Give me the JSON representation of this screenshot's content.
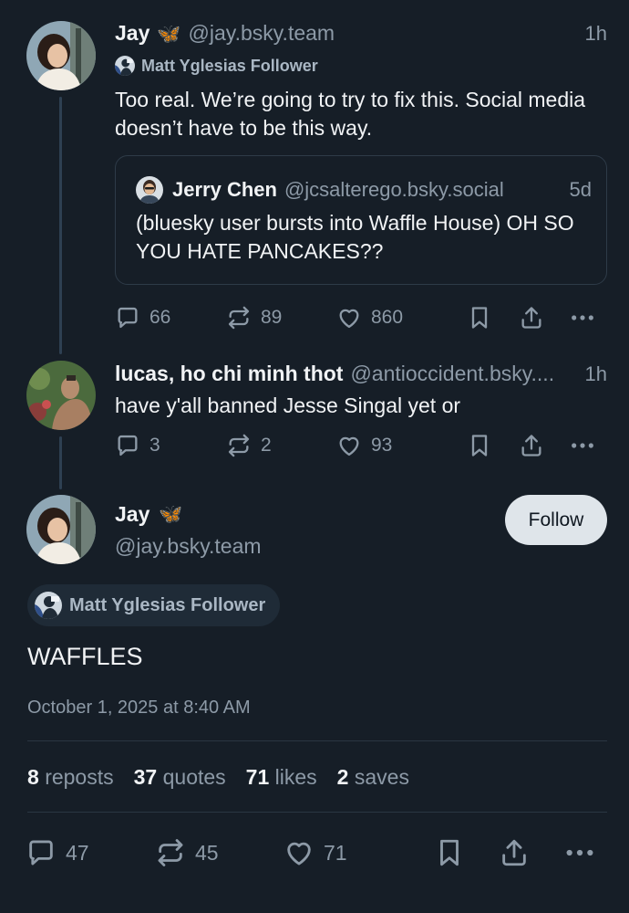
{
  "thread": [
    {
      "author_name": "Jay",
      "author_emoji": "🦋",
      "handle": "@jay.bsky.team",
      "time": "1h",
      "badge": "Matt Yglesias Follower",
      "text": "Too real. We’re going to try to fix this. Social media doesn’t have to be this way.",
      "quote": {
        "author_name": "Jerry Chen",
        "handle": "@jcsalterego.bsky.social",
        "time": "5d",
        "text": "(bluesky user bursts into Waffle House) OH SO YOU HATE PANCAKES??"
      },
      "replies": "66",
      "reposts": "89",
      "likes": "860"
    },
    {
      "author_name": "lucas, ho chi minh thot",
      "handle": "@antioccident.bsky....",
      "time": "1h",
      "text": "have y'all banned Jesse Singal yet or",
      "replies": "3",
      "reposts": "2",
      "likes": "93"
    }
  ],
  "main_post": {
    "author_name": "Jay",
    "author_emoji": "🦋",
    "handle": "@jay.bsky.team",
    "follow_label": "Follow",
    "badge": "Matt Yglesias Follower",
    "text": "WAFFLES",
    "timestamp": "October 1, 2025 at 8:40 AM",
    "stats": {
      "reposts_count": "8",
      "reposts_label": "reposts",
      "quotes_count": "37",
      "quotes_label": "quotes",
      "likes_count": "71",
      "likes_label": "likes",
      "saves_count": "2",
      "saves_label": "saves"
    },
    "actions": {
      "replies": "47",
      "reposts": "45",
      "likes": "71"
    }
  },
  "icons": [
    "reply-icon",
    "repost-icon",
    "like-icon",
    "bookmark-icon",
    "share-icon",
    "more-icon"
  ],
  "colors": {
    "background": "#161e27",
    "muted": "#8d9aa7",
    "text": "#f1f3f5",
    "follow_bg": "#dfe5ea"
  }
}
